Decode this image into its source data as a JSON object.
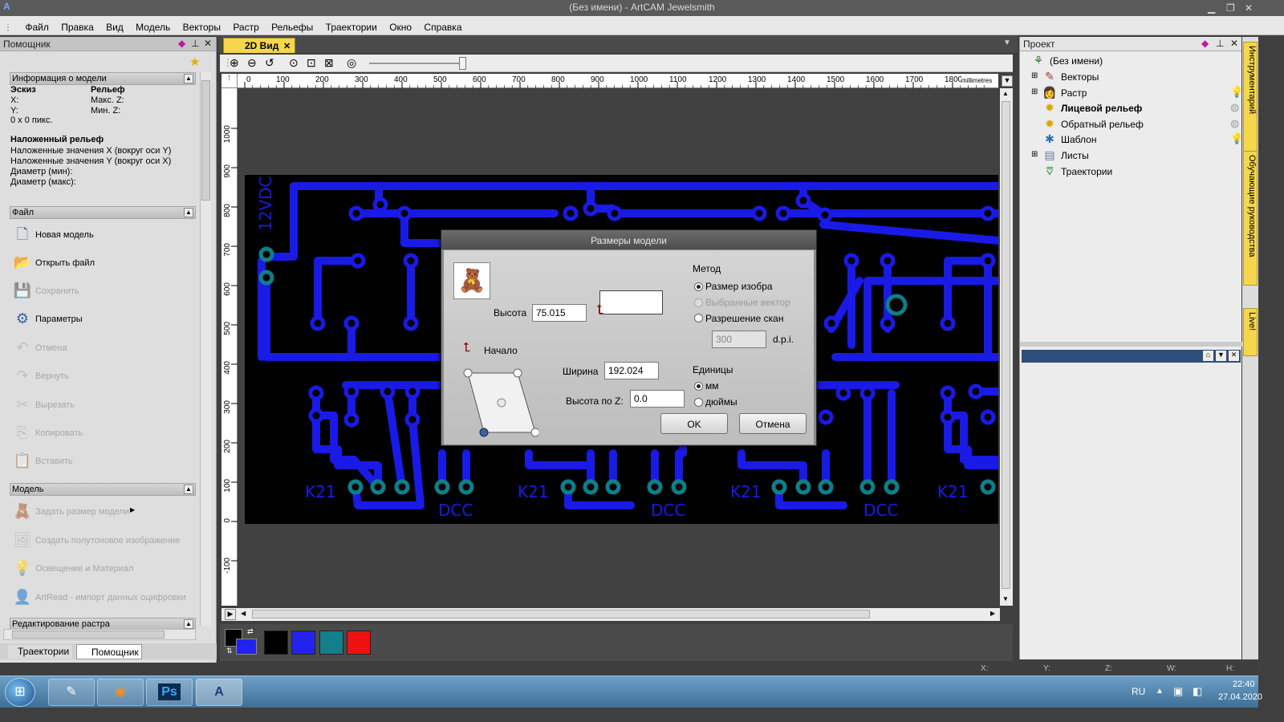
{
  "window": {
    "title": "(Без имени) - ArtCAM Jewelsmith",
    "min": "▁",
    "restore": "❐",
    "close": "✕"
  },
  "menu": [
    "Файл",
    "Правка",
    "Вид",
    "Модель",
    "Векторы",
    "Растр",
    "Рельефы",
    "Траектории",
    "Окно",
    "Справка"
  ],
  "left_panel": {
    "title": "Помощник",
    "sections": {
      "info": "Информация о модели",
      "file": "Файл",
      "model": "Модель",
      "raster": "Редактирование растра"
    },
    "info": {
      "sketch": "Эскиз",
      "relief": "Рельеф",
      "x": "X:",
      "y": "Y:",
      "maxz": "Макс. Z:",
      "minz": "Мин. Z:",
      "size": "0 x 0 пикс.",
      "wrap_title": "Наложенный рельеф",
      "wrap_x": "Наложенные значения X (вокруг оси Y)",
      "wrap_y": "Наложенные значения Y (вокруг оси X)",
      "dmin": "Диаметр (мин):",
      "dmax": "Диаметр (макс):"
    },
    "file_items": [
      {
        "label": "Новая модель",
        "icon": "new-model-icon",
        "glyph": "🗋"
      },
      {
        "label": "Открыть файл",
        "icon": "open-file-icon",
        "glyph": "📂"
      },
      {
        "label": "Сохранить",
        "icon": "save-icon",
        "glyph": "💾"
      },
      {
        "label": "Параметры",
        "icon": "parameters-icon",
        "glyph": "⚙"
      },
      {
        "label": "Отмена",
        "icon": "undo-icon",
        "glyph": "↶"
      },
      {
        "label": "Вернуть",
        "icon": "redo-icon",
        "glyph": "↷"
      },
      {
        "label": "Вырезать",
        "icon": "cut-icon",
        "glyph": "✂"
      },
      {
        "label": "Копировать",
        "icon": "copy-icon",
        "glyph": "⎘"
      },
      {
        "label": "Вставить",
        "icon": "paste-icon",
        "glyph": "📋"
      }
    ],
    "model_items": [
      {
        "label": "Задать размер модели",
        "icon": "set-model-size-icon",
        "glyph": "🧸"
      },
      {
        "label": "Создать полутоновое изображение",
        "icon": "grayscale-icon",
        "glyph": "🖼"
      },
      {
        "label": "Освещение и Материал",
        "icon": "lighting-icon",
        "glyph": "💡"
      },
      {
        "label": "ArtRead - импорт данных оцифровки",
        "icon": "artread-icon",
        "glyph": "👤"
      }
    ],
    "bottom_tabs": [
      "Траектории",
      "Помощник"
    ]
  },
  "view": {
    "tab": "2D Вид",
    "ruler_top": [
      "0",
      "100",
      "200",
      "300",
      "400",
      "500",
      "600",
      "700",
      "800",
      "900",
      "1000",
      "1100",
      "1200",
      "1300",
      "1400",
      "1500",
      "1600",
      "1700",
      "1800"
    ],
    "ruler_unit": "millimetres",
    "ruler_left": [
      "1000",
      "900",
      "800",
      "700",
      "600",
      "500",
      "400",
      "300",
      "200",
      "100",
      "0",
      "-100"
    ]
  },
  "pcb": {
    "labels": [
      "12VDC",
      "K21",
      "DCC",
      "K21",
      "DCC",
      "K21",
      "DCC",
      "K21"
    ],
    "trace_color": "#1a1ae6",
    "pad_color": "#0e7f8a"
  },
  "palette": {
    "colors": [
      "#000000",
      "#2222ee",
      "#137f8e",
      "#ee1111"
    ],
    "primary": "#000000",
    "secondary": "#2222ee"
  },
  "project": {
    "title": "Проект",
    "root": "(Без имени)",
    "items": [
      {
        "label": "Векторы",
        "icon": "vectors-icon",
        "glyph": "✎",
        "bold": false
      },
      {
        "label": "Растр",
        "icon": "raster-icon",
        "glyph": "👩",
        "bold": false
      },
      {
        "label": "Лицевой рельеф",
        "icon": "front-relief-icon",
        "glyph": "✹",
        "bold": true
      },
      {
        "label": "Обратный рельеф",
        "icon": "back-relief-icon",
        "glyph": "✹",
        "bold": false
      },
      {
        "label": "Шаблон",
        "icon": "template-icon",
        "glyph": "✱",
        "bold": false
      },
      {
        "label": "Листы",
        "icon": "sheets-icon",
        "glyph": "▤",
        "bold": false
      },
      {
        "label": "Траектории",
        "icon": "toolpaths-icon",
        "glyph": "⩢",
        "bold": false
      }
    ]
  },
  "side_tabs": [
    "Инструментарий",
    "Обучающие руководства",
    "Live!"
  ],
  "status": {
    "x": "X:",
    "y": "Y:",
    "z": "Z:",
    "w": "W:",
    "h": "H:"
  },
  "taskbar": {
    "lang": "RU",
    "time": "22:40",
    "date": "27.04.2020",
    "ps": "Ps"
  },
  "dialog": {
    "title": "Размеры модели",
    "height_label": "Высота",
    "height_value": "75.015",
    "width_label": "Ширина",
    "width_value": "192.024",
    "zheight_label": "Высота по Z:",
    "zheight_value": "0.0",
    "origin_label": "Начало",
    "method_label": "Метод",
    "methods": [
      "Размер изобра",
      "Выбранные вектор",
      "Разрешение скан"
    ],
    "dpi_value": "300",
    "dpi_label": "d.p.i.",
    "units_label": "Единицы",
    "units": [
      "мм",
      "дюймы"
    ],
    "ok": "OK",
    "cancel": "Отмена"
  }
}
